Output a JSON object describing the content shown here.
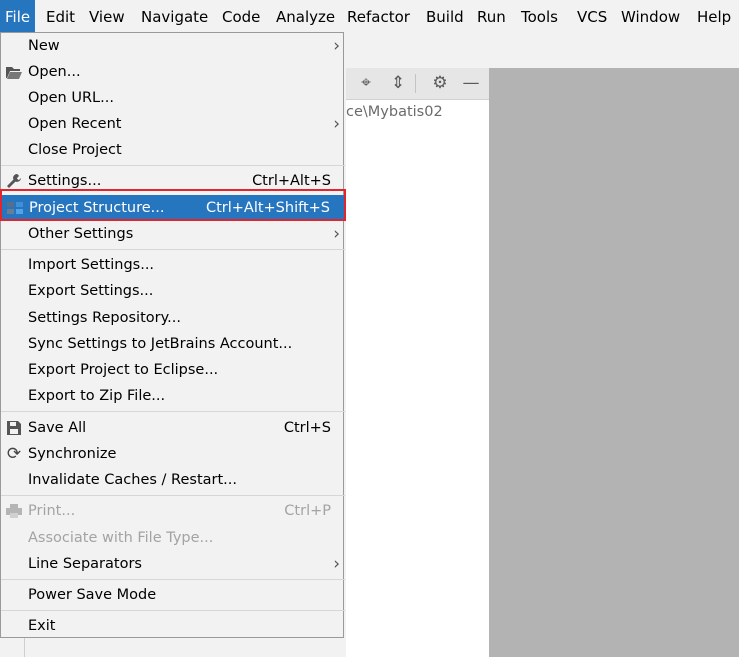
{
  "menubar": {
    "file": "File",
    "edit": "Edit",
    "view": "View",
    "navigate": "Navigate",
    "code": "Code",
    "analyze": "Analyze",
    "refactor": "Refactor",
    "build": "Build",
    "run": "Run",
    "tools": "Tools",
    "vcs": "VCS",
    "window": "Window",
    "help": "Help"
  },
  "project": {
    "path_text": "ce\\Mybatis02"
  },
  "menu": {
    "new": "New",
    "open": "Open...",
    "open_url": "Open URL...",
    "open_recent": "Open Recent",
    "close_project": "Close Project",
    "settings": "Settings...",
    "settings_shortcut": "Ctrl+Alt+S",
    "project_structure": "Project Structure...",
    "project_structure_shortcut": "Ctrl+Alt+Shift+S",
    "other_settings": "Other Settings",
    "import_settings": "Import Settings...",
    "export_settings": "Export Settings...",
    "settings_repository": "Settings Repository...",
    "sync_settings": "Sync Settings to JetBrains Account...",
    "export_eclipse": "Export Project to Eclipse...",
    "export_zip": "Export to Zip File...",
    "save_all": "Save All",
    "save_all_shortcut": "Ctrl+S",
    "synchronize": "Synchronize",
    "invalidate": "Invalidate Caches / Restart...",
    "print": "Print...",
    "print_shortcut": "Ctrl+P",
    "associate": "Associate with File Type...",
    "line_separators": "Line Separators",
    "power_save": "Power Save Mode",
    "exit": "Exit"
  },
  "colors": {
    "accent": "#2675bf",
    "highlight_border": "#e2242c"
  }
}
